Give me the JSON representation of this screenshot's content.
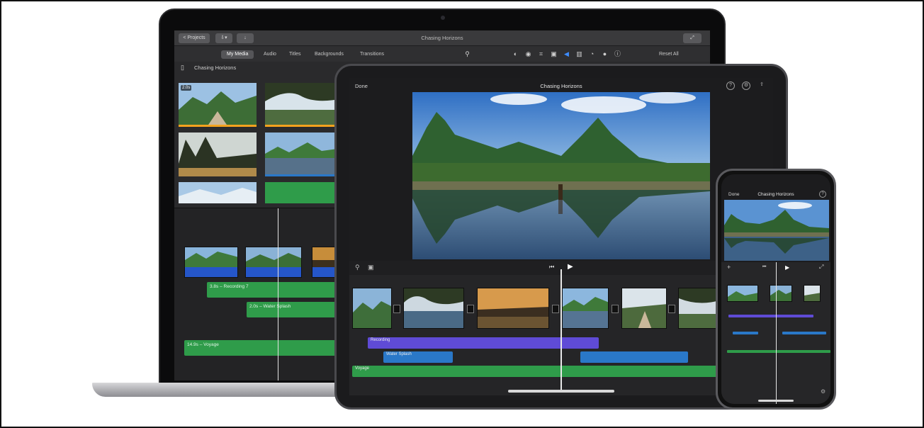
{
  "macbook": {
    "toolbar": {
      "projects_label": "< Projects",
      "title": "Chasing Horizons"
    },
    "tabs": [
      "My Media",
      "Audio",
      "Titles",
      "Backgrounds",
      "Transitions"
    ],
    "active_tab": "My Media",
    "reset_all_label": "Reset All",
    "library_name": "Chasing Horizons",
    "duration_badge": "2.0s",
    "timeline": {
      "recording_label": "3.8s – Recording 7",
      "water_label": "2.0s – Water Splash",
      "voyage_label": "14.9s – Voyage"
    }
  },
  "ipad": {
    "done_label": "Done",
    "title": "Chasing Horizons",
    "tracks": {
      "recording": "Recording",
      "water": "Water Splash",
      "voyage": "Voyage"
    }
  },
  "iphone": {
    "done_label": "Done",
    "title": "Chasing Horizons"
  },
  "colors": {
    "accent_blue": "#3d8cff",
    "clip_orange": "#f4a21e",
    "music_green": "#2f9c4a",
    "voice_purple": "#5f4bd6",
    "sfx_blue": "#2a78c8"
  }
}
